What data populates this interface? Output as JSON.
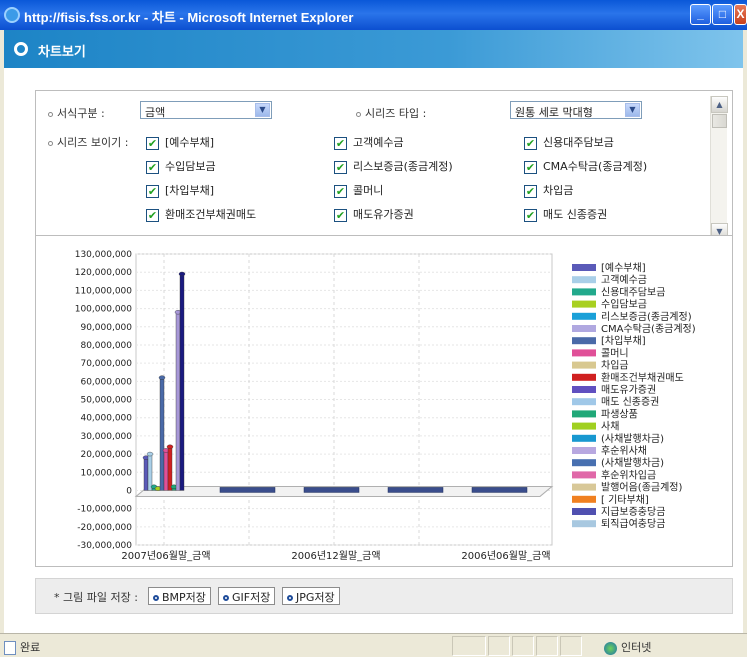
{
  "window": {
    "title": "http://fisis.fss.or.kr - 차트 - Microsoft Internet Explorer"
  },
  "page": {
    "title": "차트보기"
  },
  "options": {
    "format_label": "서식구분 :",
    "format_value": "금액",
    "series_type_label": "시리즈 타입 :",
    "series_type_value": "원통 세로 막대형",
    "series_show_label": "시리즈 보이기 :",
    "checkboxes": [
      "[예수부채]",
      "고객예수금",
      "신용대주담보금",
      "수입담보금",
      "리스보증금(종금계정)",
      "CMA수탁금(종금계정)",
      "[차입부채]",
      "콜머니",
      "차입금",
      "환매조건부채권매도",
      "매도유가증권",
      "매도 신종증권"
    ]
  },
  "chart_data": {
    "type": "bar",
    "categories": [
      "2007년06월말_금액",
      "2006년12월말_금액",
      "2006년06월말_금액"
    ],
    "ylim": [
      -30000000,
      130000000
    ],
    "yticks": [
      "130,000,000",
      "120,000,000",
      "110,000,000",
      "100,000,000",
      "90,000,000",
      "80,000,000",
      "70,000,000",
      "60,000,000",
      "50,000,000",
      "40,000,000",
      "30,000,000",
      "20,000,000",
      "10,000,000",
      "0",
      "-10,000,000",
      "-20,000,000",
      "-30,000,000"
    ],
    "legend_position": "right",
    "series": [
      {
        "name": "[예수부채]",
        "color": "#5a5ab8",
        "values": [
          18000000,
          0,
          0
        ]
      },
      {
        "name": "고객예수금",
        "color": "#a9cfe8",
        "values": [
          20000000,
          0,
          0
        ]
      },
      {
        "name": "신용대주담보금",
        "color": "#22a98c",
        "values": [
          2000000,
          0,
          0
        ]
      },
      {
        "name": "수입담보금",
        "color": "#a8d020",
        "values": [
          1000000,
          0,
          0
        ]
      },
      {
        "name": "리스보증금(종금계정)",
        "color": "#1aa0d8",
        "values": [
          0,
          0,
          0
        ]
      },
      {
        "name": "CMA수탁금(종금계정)",
        "color": "#b0a8e0",
        "values": [
          0,
          0,
          0
        ]
      },
      {
        "name": "[차입부채]",
        "color": "#4a6aa8",
        "values": [
          62000000,
          0,
          0
        ]
      },
      {
        "name": "콜머니",
        "color": "#e05098",
        "values": [
          22000000,
          0,
          0
        ]
      },
      {
        "name": "차입금",
        "color": "#d8c890",
        "values": [
          0,
          0,
          0
        ]
      },
      {
        "name": "환매조건부채권매도",
        "color": "#d02020",
        "values": [
          24000000,
          0,
          0
        ]
      },
      {
        "name": "매도유가증권",
        "color": "#6050c0",
        "values": [
          0,
          0,
          0
        ]
      },
      {
        "name": "매도 신종증권",
        "color": "#a0c8e8",
        "values": [
          0,
          0,
          0
        ]
      },
      {
        "name": "파생상품",
        "color": "#20a878",
        "values": [
          2000000,
          0,
          0
        ]
      },
      {
        "name": "사채",
        "color": "#a0d020",
        "values": [
          0,
          0,
          0
        ]
      },
      {
        "name": "(사채발행차금)",
        "color": "#1898d0",
        "values": [
          0,
          0,
          0
        ]
      },
      {
        "name": "후순위사채",
        "color": "#b8a8e0",
        "values": [
          0,
          0,
          0
        ]
      },
      {
        "name": "(사채발행차금)",
        "color": "#4870b0",
        "values": [
          0,
          0,
          0
        ]
      },
      {
        "name": "후순위차입금",
        "color": "#e068a8",
        "values": [
          0,
          0,
          0
        ]
      },
      {
        "name": "발행어음(종금계정)",
        "color": "#d8c898",
        "values": [
          0,
          0,
          0
        ]
      },
      {
        "name": "[ 기타부채]",
        "color": "#f08020",
        "values": [
          0,
          0,
          0
        ]
      },
      {
        "name": "지급보증충당금",
        "color": "#5050b0",
        "values": [
          0,
          0,
          0
        ]
      },
      {
        "name": "퇴직급여충당금",
        "color": "#a8c8e0",
        "values": [
          0,
          0,
          0
        ]
      }
    ],
    "extra_bars": [
      {
        "color": "#a898d8",
        "values": [
          98000000,
          0,
          0
        ]
      },
      {
        "color": "#1a1a80",
        "values": [
          119000000,
          0,
          0
        ]
      }
    ]
  },
  "save": {
    "label": "* 그림 파일 저장 :",
    "buttons": [
      "BMP저장",
      "GIF저장",
      "JPG저장"
    ]
  },
  "status": {
    "text": "완료",
    "zone": "인터넷"
  }
}
